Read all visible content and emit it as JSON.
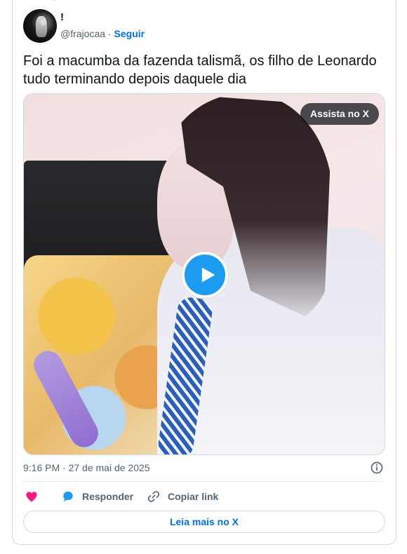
{
  "author": {
    "display_name": "!",
    "handle": "@frajocaa",
    "separator": " · ",
    "follow_label": "Seguir"
  },
  "tweet": {
    "text": "Foi a macumba da fazenda talismã, os filho de Leonardo tudo terminando depois daquele dia",
    "timestamp": "9:16 PM · 27 de mai de 2025"
  },
  "media": {
    "watch_label": "Assista no X"
  },
  "actions": {
    "reply_label": "Responder",
    "copy_link_label": "Copiar link",
    "read_more_label": "Leia mais no X"
  },
  "icons": {
    "heart": "heart-icon",
    "reply": "speech-bubble-icon",
    "link": "link-icon",
    "info": "info-icon",
    "play": "play-icon"
  },
  "colors": {
    "accent": "#1d9bf0",
    "link": "#006fd6",
    "heart": "#f91880",
    "muted": "#536471",
    "text": "#0f1419"
  }
}
